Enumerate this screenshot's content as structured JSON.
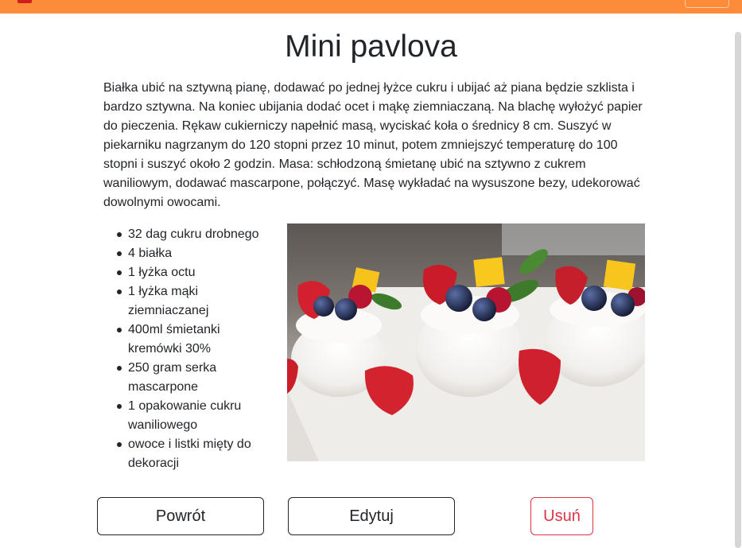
{
  "recipe": {
    "title": "Mini pavlova",
    "description": "Białka ubić na sztywną pianę, dodawać po jednej łyżce cukru i ubijać aż piana będzie szklista i bardzo sztywna. Na koniec ubijania dodać ocet i mąkę ziemniaczaną. Na blachę wyłożyć papier do pieczenia. Rękaw cukierniczy napełnić masą, wyciskać koła o średnicy 8 cm. Suszyć w piekarniku nagrzanym do 120 stopni przez 10 minut, potem zmniejszyć temperaturę do 100 stopni i suszyć około 2 godzin. Masa: schłodzoną śmietanę ubić na sztywno z cukrem waniliowym, dodawać mascarpone, połączyć. Masę wykładać na wysuszone bezy, udekorować dowolnymi owocami.",
    "ingredients": [
      "32 dag cukru drobnego",
      "4 białka",
      "1 łyżka octu",
      "1 łyżka mąki ziemniaczanej",
      "400ml śmietanki kremówki 30%",
      "250 gram serka mascarpone",
      "1 opakowanie cukru waniliowego",
      "owoce i listki mięty do dekoracji"
    ]
  },
  "actions": {
    "back_label": "Powrót",
    "edit_label": "Edytuj",
    "delete_label": "Usuń"
  },
  "theme": {
    "navbar_color": "#fd8c3a",
    "danger_color": "#dc3545",
    "text_color": "#212529"
  },
  "icons": {
    "navbar_toggler": "menu-icon"
  }
}
